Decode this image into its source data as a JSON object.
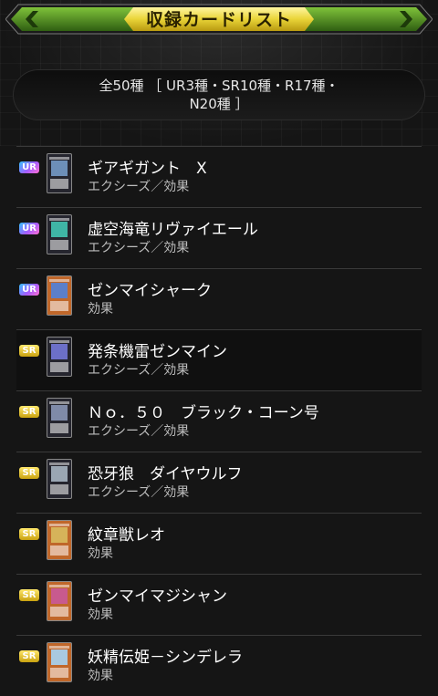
{
  "header": {
    "title": "収録カードリスト"
  },
  "summary": {
    "line1": "全50種 ［ UR3種・SR10種・R17種・",
    "line2": "N20種 ］"
  },
  "colors": {
    "header_gold": "#e9d437",
    "header_green": "#4a8a1e",
    "ur_gradient": "#35c3ff-#a55cff",
    "sr_gold": "#f0cf2a"
  },
  "cards": [
    {
      "rarity": "UR",
      "name": "ギアギガント　X",
      "type": "エクシーズ／効果",
      "frame": "xyz",
      "icon": "card-thumbnail-icon"
    },
    {
      "rarity": "UR",
      "name": "虚空海竜リヴァイエール",
      "type": "エクシーズ／効果",
      "frame": "xyz",
      "icon": "card-thumbnail-icon"
    },
    {
      "rarity": "UR",
      "name": "ゼンマイシャーク",
      "type": "効果",
      "frame": "effect",
      "icon": "card-thumbnail-icon"
    },
    {
      "rarity": "SR",
      "name": "発条機雷ゼンマイン",
      "type": "エクシーズ／効果",
      "frame": "xyz",
      "icon": "card-thumbnail-icon"
    },
    {
      "rarity": "SR",
      "name": "Ｎｏ．５０　ブラック・コーン号",
      "type": "エクシーズ／効果",
      "frame": "xyz",
      "icon": "card-thumbnail-icon"
    },
    {
      "rarity": "SR",
      "name": "恐牙狼　ダイヤウルフ",
      "type": "エクシーズ／効果",
      "frame": "xyz",
      "icon": "card-thumbnail-icon"
    },
    {
      "rarity": "SR",
      "name": "紋章獣レオ",
      "type": "効果",
      "frame": "effect",
      "icon": "card-thumbnail-icon"
    },
    {
      "rarity": "SR",
      "name": "ゼンマイマジシャン",
      "type": "効果",
      "frame": "effect",
      "icon": "card-thumbnail-icon"
    },
    {
      "rarity": "SR",
      "name": "妖精伝姫－シンデレラ",
      "type": "効果",
      "frame": "effect",
      "icon": "card-thumbnail-icon"
    }
  ]
}
